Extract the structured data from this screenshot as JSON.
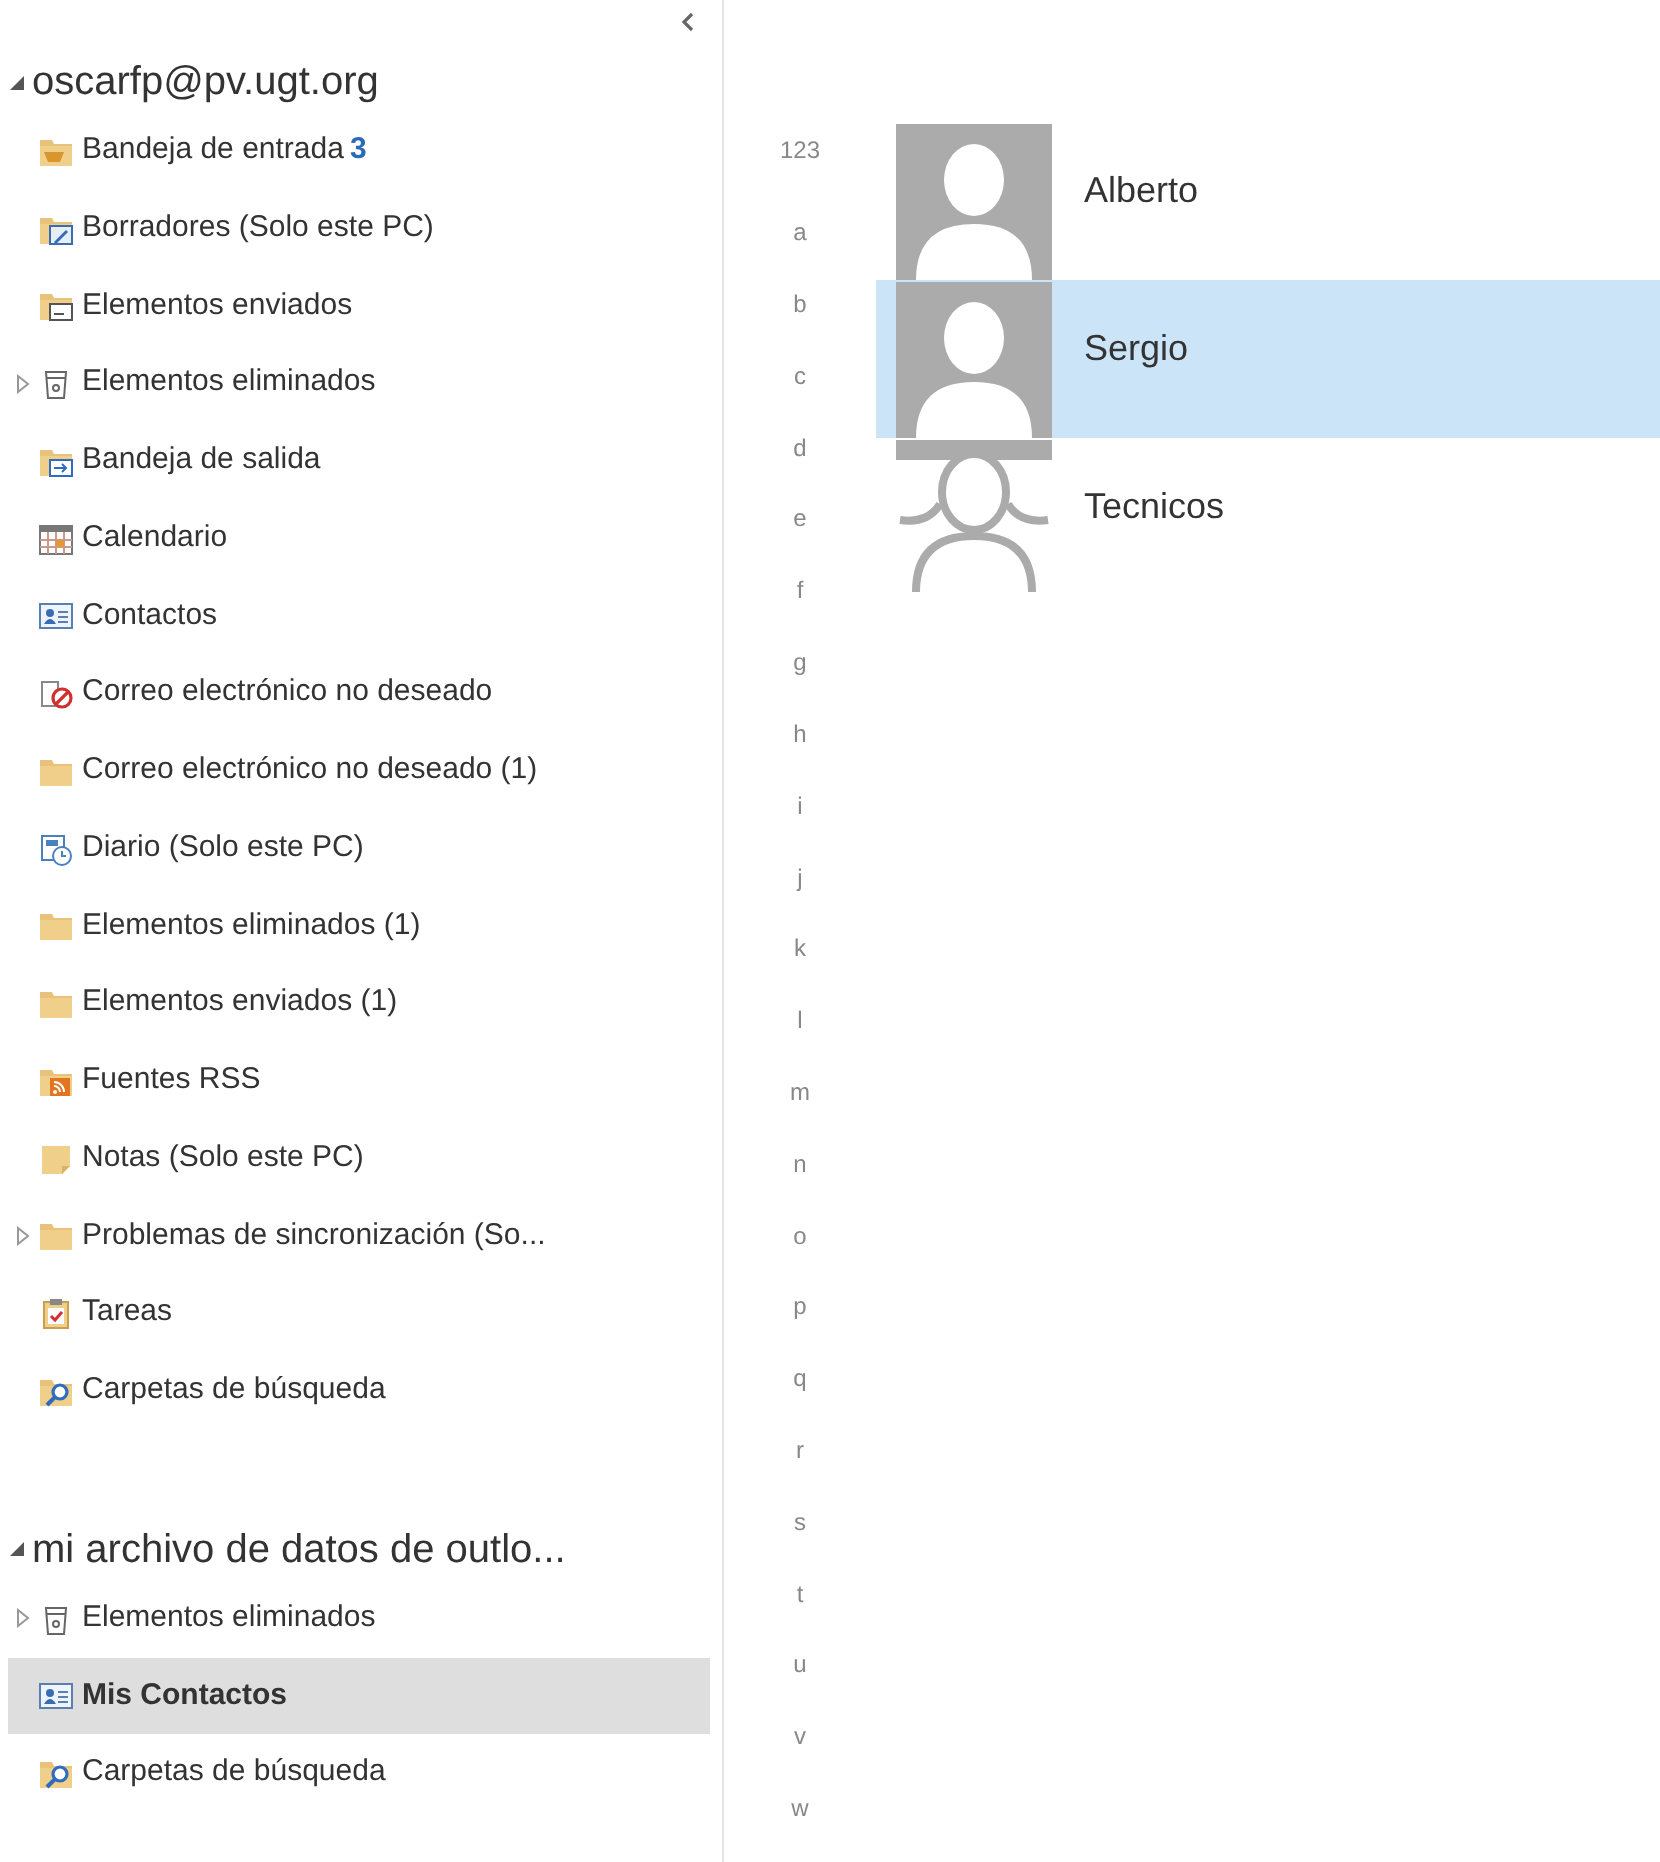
{
  "accounts": [
    {
      "title": "oscarfp@pv.ugt.org",
      "expanded": true,
      "folders": [
        {
          "label": "Bandeja de entrada",
          "count": "3",
          "kind": "inbox",
          "expandable": false,
          "selected": false
        },
        {
          "label": "Borradores (Solo este PC)",
          "kind": "drafts",
          "expandable": false,
          "selected": false
        },
        {
          "label": "Elementos enviados",
          "kind": "sent",
          "expandable": false,
          "selected": false
        },
        {
          "label": "Elementos eliminados",
          "kind": "trash",
          "expandable": true,
          "selected": false
        },
        {
          "label": "Bandeja de salida",
          "kind": "outbox",
          "expandable": false,
          "selected": false
        },
        {
          "label": "Calendario",
          "kind": "calendar",
          "expandable": false,
          "selected": false
        },
        {
          "label": "Contactos",
          "kind": "contacts",
          "expandable": false,
          "selected": false
        },
        {
          "label": "Correo electrónico no deseado",
          "kind": "junk",
          "expandable": false,
          "selected": false
        },
        {
          "label": "Correo electrónico no deseado (1)",
          "kind": "folder",
          "expandable": false,
          "selected": false
        },
        {
          "label": "Diario (Solo este PC)",
          "kind": "journal",
          "expandable": false,
          "selected": false
        },
        {
          "label": "Elementos eliminados (1)",
          "kind": "folder",
          "expandable": false,
          "selected": false
        },
        {
          "label": "Elementos enviados (1)",
          "kind": "folder",
          "expandable": false,
          "selected": false
        },
        {
          "label": "Fuentes RSS",
          "kind": "rss",
          "expandable": false,
          "selected": false
        },
        {
          "label": "Notas (Solo este PC)",
          "kind": "notes",
          "expandable": false,
          "selected": false
        },
        {
          "label": "Problemas de sincronización (So...",
          "kind": "folder",
          "expandable": true,
          "selected": false
        },
        {
          "label": "Tareas",
          "kind": "tasks",
          "expandable": false,
          "selected": false
        },
        {
          "label": "Carpetas de búsqueda",
          "kind": "search",
          "expandable": false,
          "selected": false
        }
      ]
    },
    {
      "title": "mi archivo de datos de outlo...",
      "expanded": true,
      "folders": [
        {
          "label": "Elementos eliminados",
          "kind": "trash",
          "expandable": true,
          "selected": false
        },
        {
          "label": "Mis Contactos",
          "kind": "contacts",
          "expandable": false,
          "selected": true
        },
        {
          "label": "Carpetas de búsqueda",
          "kind": "search",
          "expandable": false,
          "selected": false
        }
      ]
    }
  ],
  "index": [
    "123",
    "a",
    "b",
    "c",
    "d",
    "e",
    "f",
    "g",
    "h",
    "i",
    "j",
    "k",
    "l",
    "m",
    "n",
    "o",
    "p",
    "q",
    "r",
    "s",
    "t",
    "u",
    "v",
    "w"
  ],
  "contacts": [
    {
      "name": "Alberto",
      "kind": "person",
      "selected": false
    },
    {
      "name": "Sergio",
      "kind": "person",
      "selected": true
    },
    {
      "name": "Tecnicos",
      "kind": "group",
      "selected": false
    }
  ]
}
